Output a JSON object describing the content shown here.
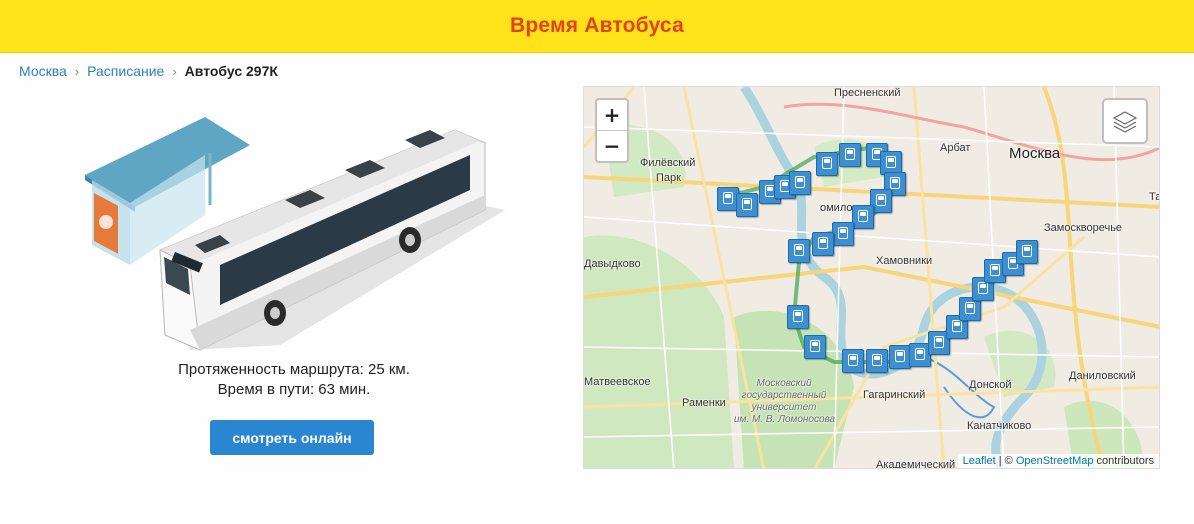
{
  "header": {
    "title": "Время Автобуса"
  },
  "breadcrumb": {
    "items": [
      "Москва",
      "Расписание"
    ],
    "current": "Автобус 297К"
  },
  "route": {
    "length": "Протяженность маршрута: 25 км.",
    "duration": "Время в пути: 63 мин."
  },
  "button": {
    "label": "смотреть онлайн"
  },
  "map": {
    "zoom_in": "+",
    "zoom_out": "−",
    "labels": {
      "presnensky": "Пресненский",
      "arbat": "Арбат",
      "moskva": "Москва",
      "filevsky": "Филёвский Парк",
      "fili": "Филёвский",
      "park": "Парк",
      "dorogomilovo": "омилово",
      "zamoskvorechye": "Замоскворечье",
      "davydkovo": "Давыдково",
      "khamovniki": "Хамовники",
      "ochakovo": "Матвеевское",
      "ramenki": "Раменки",
      "gagarinsky": "Гагаринский",
      "donskoy": "Донской",
      "danilovsky": "Даниловский",
      "kanatchikovo": "Канатчиково",
      "akademichesky": "Академический",
      "ta": "Та",
      "uni1": "Московский",
      "uni2": "государственный",
      "uni3": "университет",
      "uni4": "им. М. В. Ломоносова"
    },
    "attribution": {
      "leaflet": "Leaflet",
      "sep": " | © ",
      "osm": "OpenStreetMap",
      "suffix": " contributors"
    }
  }
}
